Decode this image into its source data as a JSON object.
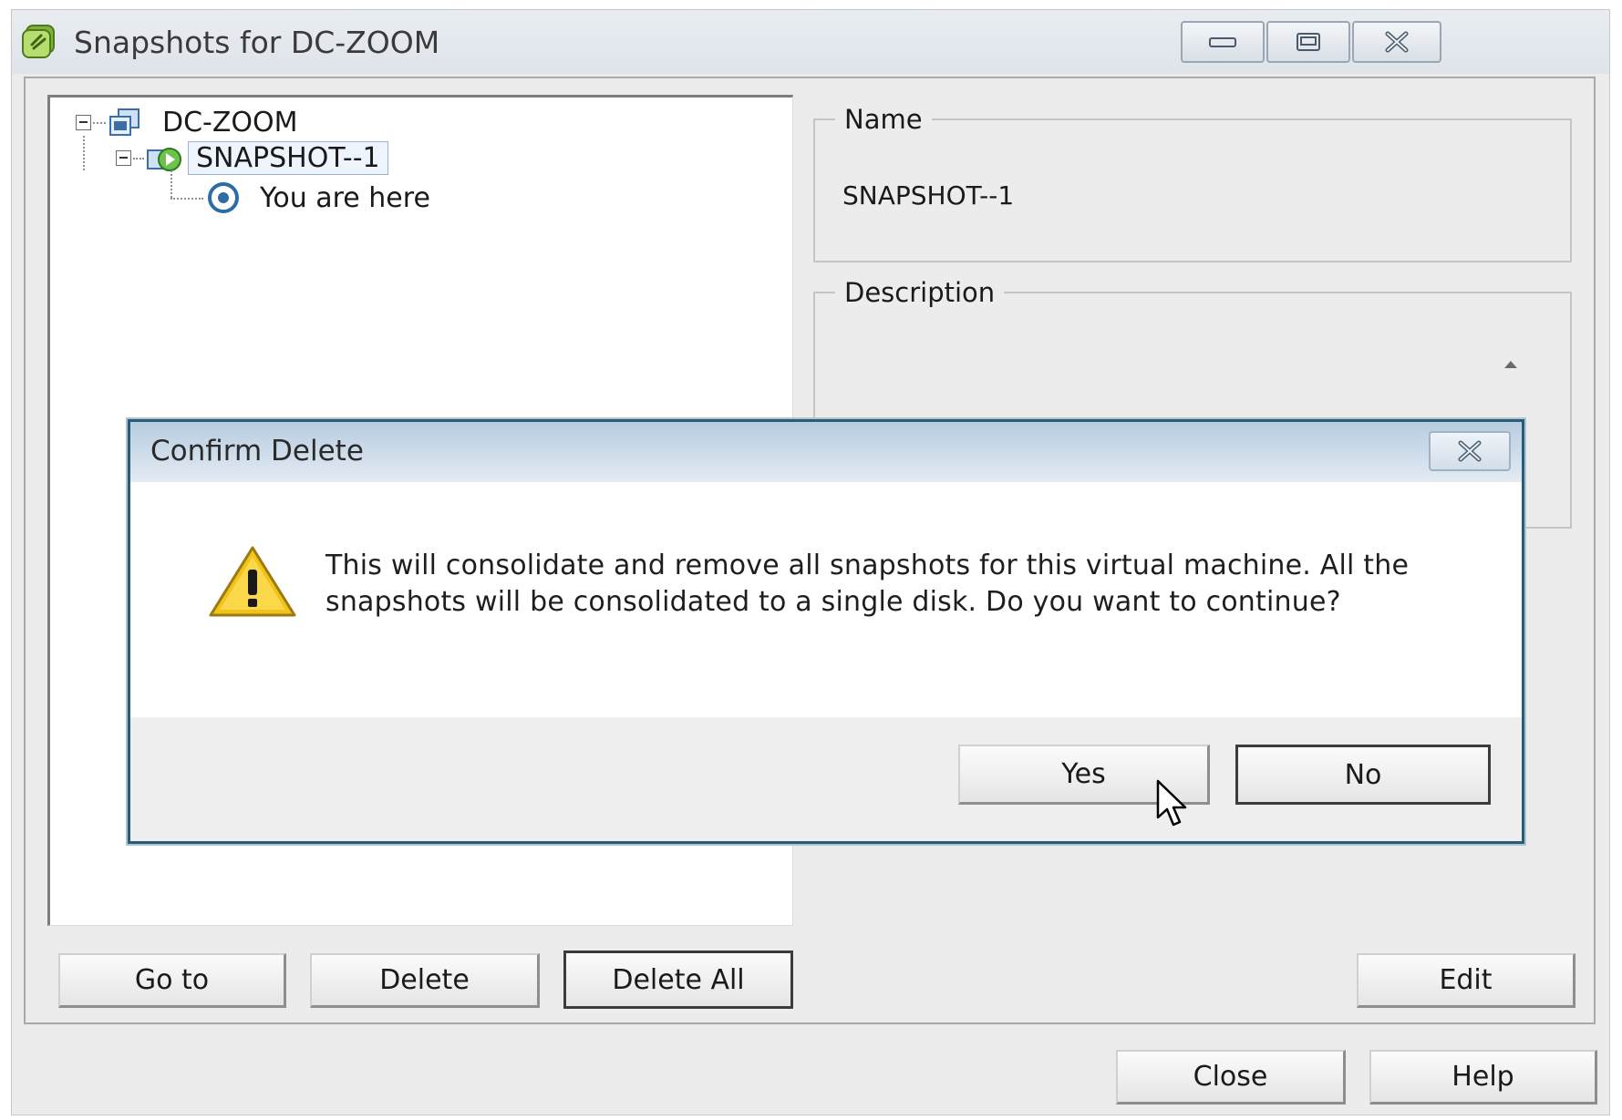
{
  "window": {
    "title": "Snapshots for DC-ZOOM",
    "controls": [
      "minimize",
      "maximize",
      "close"
    ]
  },
  "tree": {
    "root": {
      "label": "DC-ZOOM"
    },
    "snapshot": {
      "label": "SNAPSHOT--1"
    },
    "current": {
      "label": "You are here"
    }
  },
  "details": {
    "name_label": "Name",
    "name_value": "SNAPSHOT--1",
    "description_label": "Description",
    "description_value": ""
  },
  "buttons": {
    "goto": "Go to",
    "delete": "Delete",
    "delete_all": "Delete All",
    "edit": "Edit",
    "close": "Close",
    "help": "Help"
  },
  "dialog": {
    "title": "Confirm Delete",
    "message": "This will consolidate and remove all snapshots for this virtual machine. All the snapshots will be consolidated to a single disk. Do you want to continue?",
    "yes": "Yes",
    "no": "No"
  },
  "colors": {
    "dialog_border": "#2d5b72",
    "dialog_titlebar": "#b7cce0",
    "warning_yellow": "#f2c31a",
    "snapshot_green": "#3fae3f"
  }
}
